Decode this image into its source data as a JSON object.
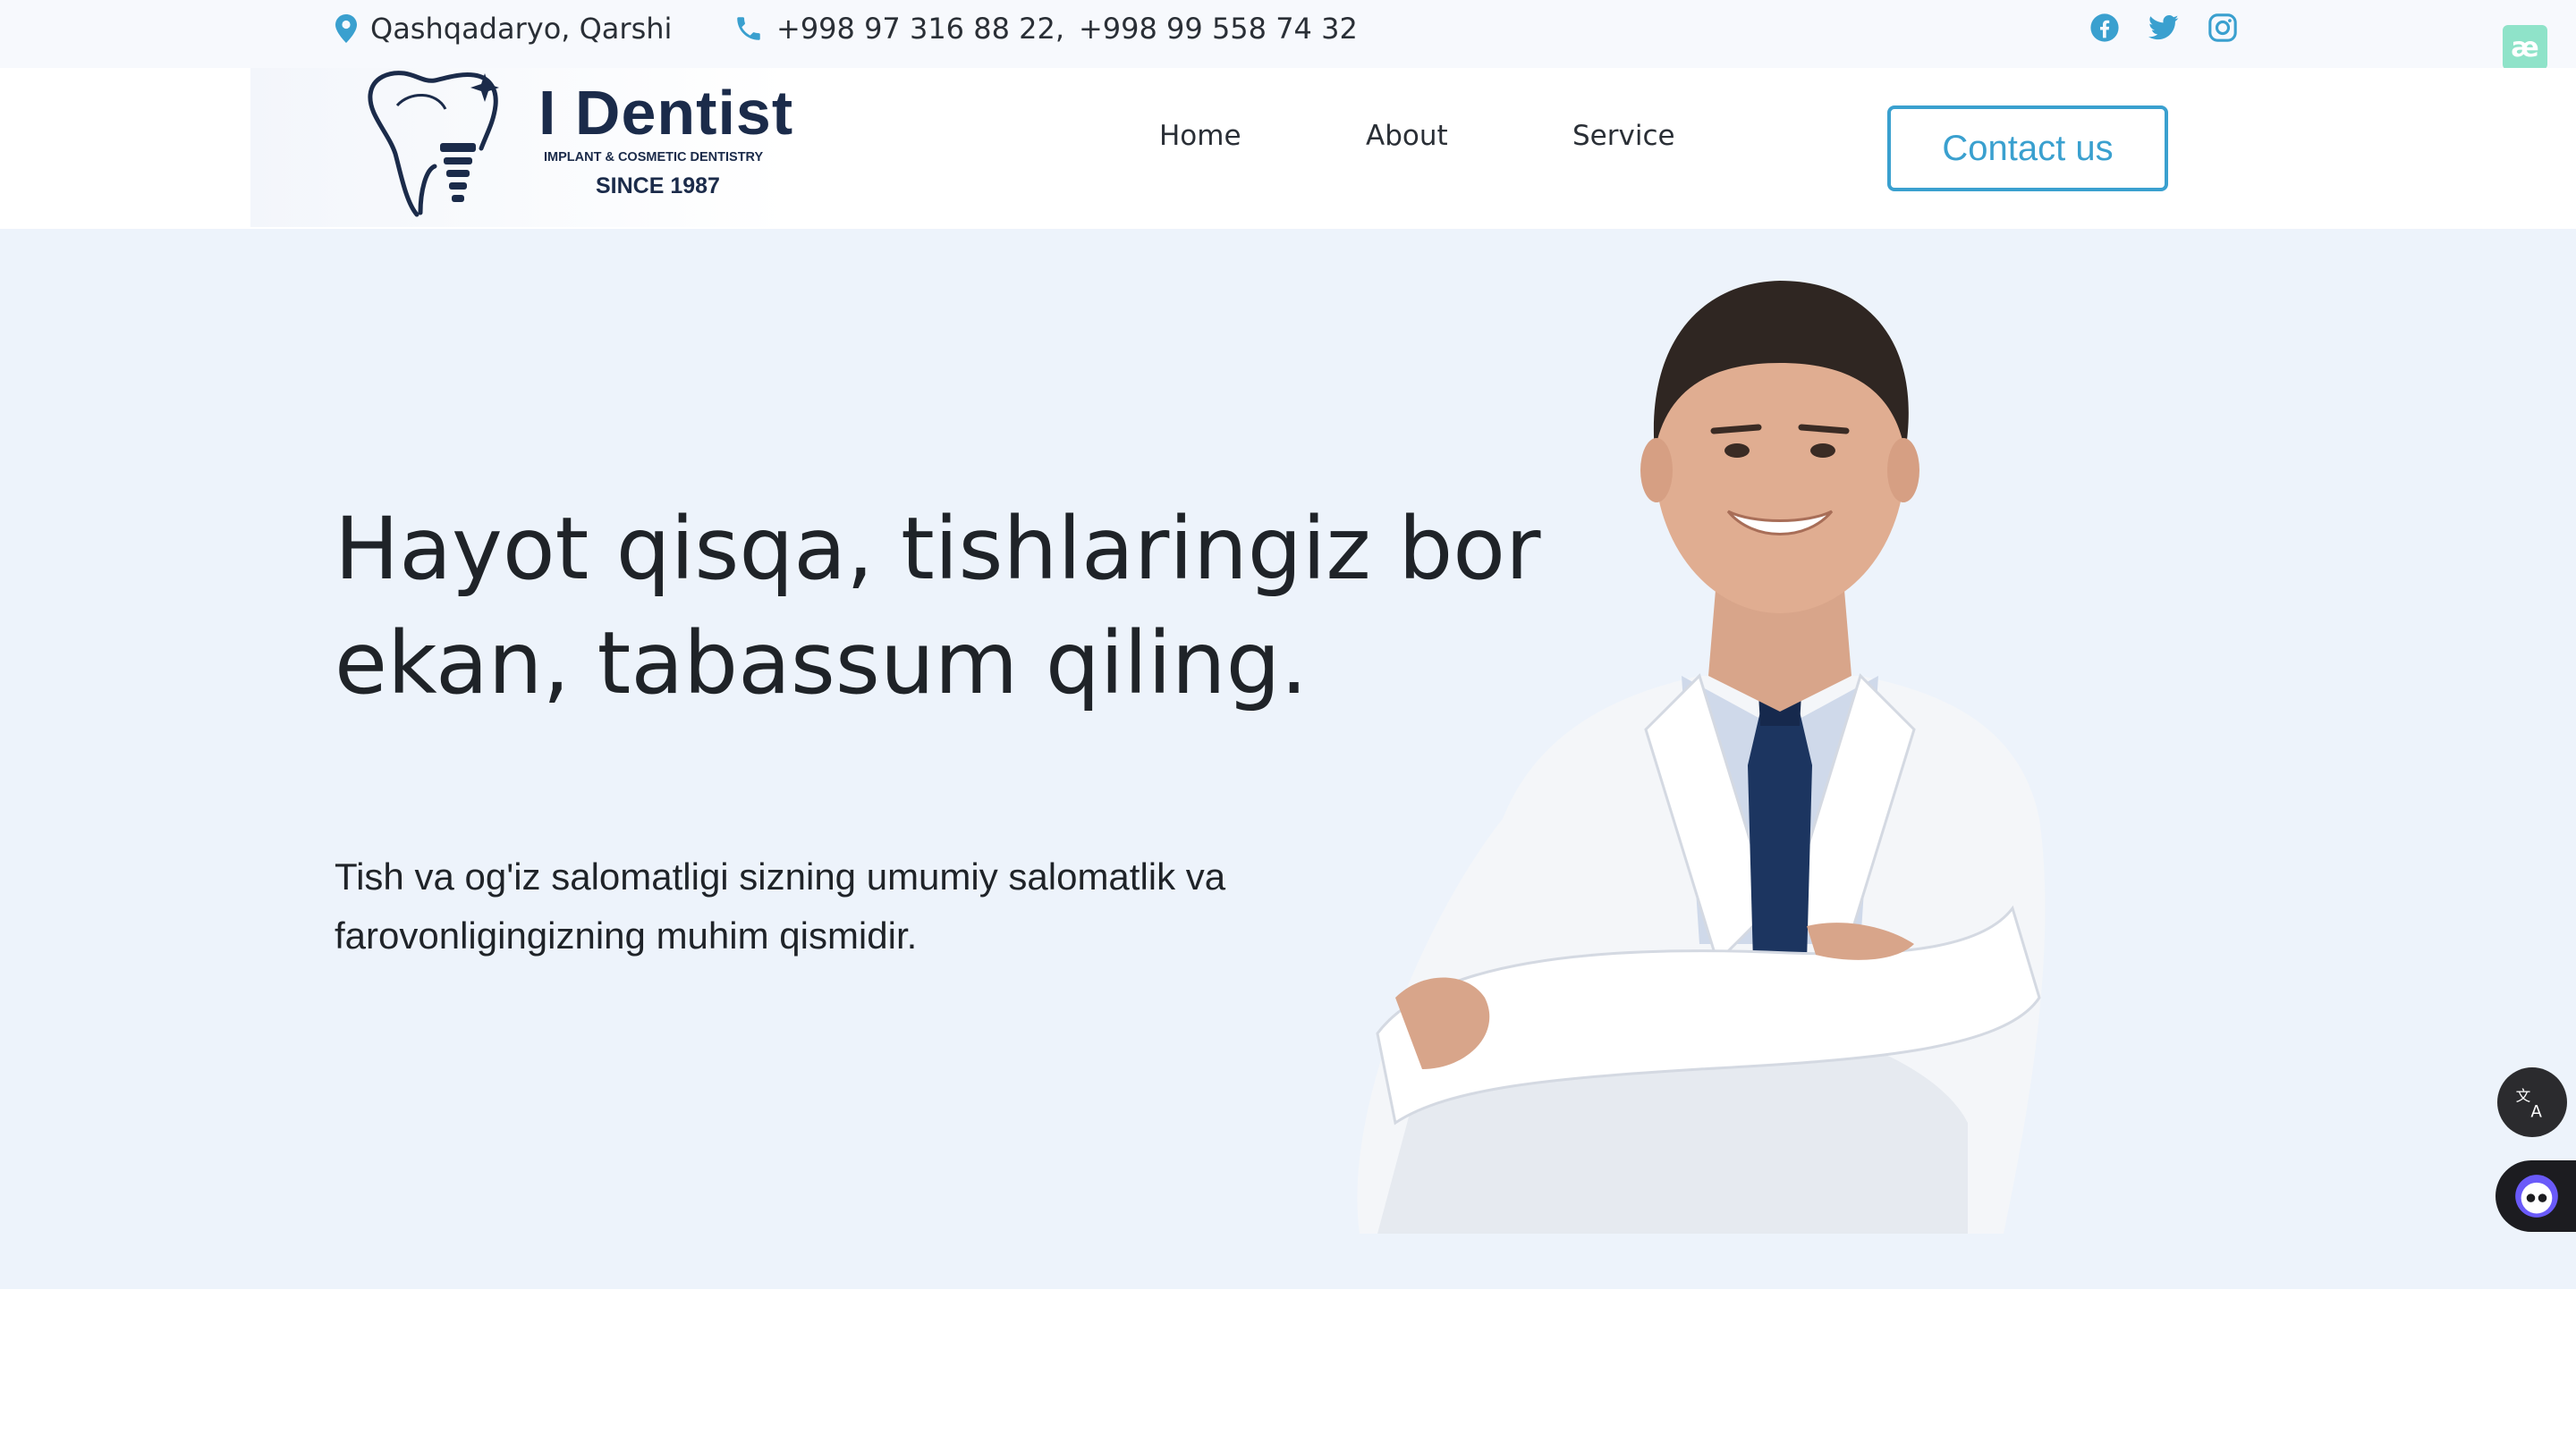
{
  "topbar": {
    "location": "Qashqadaryo, Qarshi",
    "phone1": "+998 97 316 88 22,",
    "phone2": "+998 99 558 74 32",
    "social_icons": [
      "facebook-icon",
      "twitter-icon",
      "instagram-icon"
    ],
    "extension_badge": "æ"
  },
  "logo": {
    "name": "I Dentist",
    "tagline": "IMPLANT & COSMETIC DENTISTRY",
    "since": "SINCE 1987"
  },
  "nav": {
    "home": "Home",
    "about": "About",
    "service": "Service",
    "contact": "Contact us"
  },
  "hero": {
    "title": "Hayot qisqa, tishlaringiz bor ekan, tabassum qiling.",
    "subtitle": "Tish va og'iz salomatligi sizning umumiy salomatlik va farovonligingizning muhim qismidir."
  },
  "colors": {
    "accent": "#3aa0cf",
    "brand_navy": "#1b2b4a",
    "hero_bg": "#edf3fb",
    "topbar_bg": "#f7f9fd"
  },
  "floating": {
    "translate_icon": "translate-icon",
    "assistant_icon": "assistant-icon"
  }
}
